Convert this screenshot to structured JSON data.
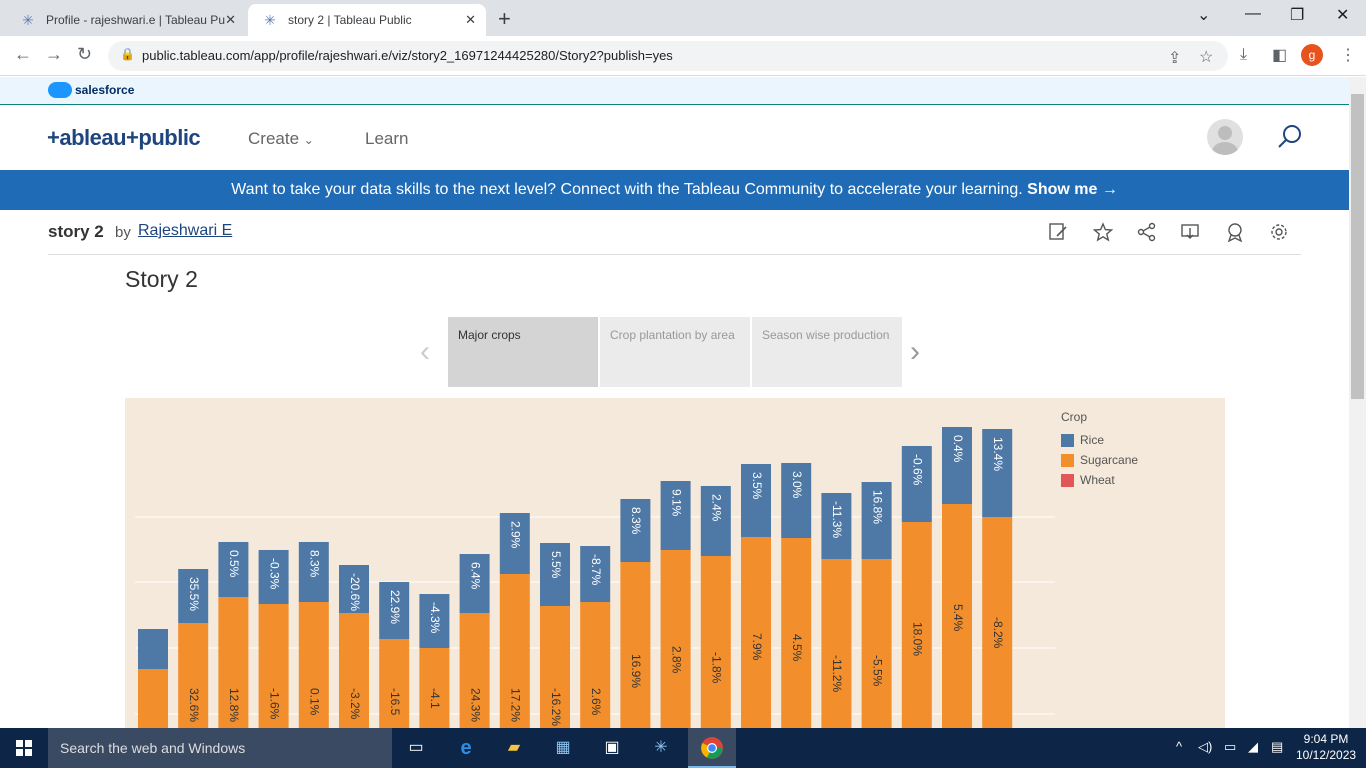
{
  "browser": {
    "tabs": [
      {
        "title": "Profile - rajeshwari.e | Tableau Pu"
      },
      {
        "title": "story 2 | Tableau Public"
      }
    ],
    "url": "public.tableau.com/app/profile/rajeshwari.e/viz/story2_16971244425280/Story2?publish=yes",
    "profile_initial": "g"
  },
  "salesforce": {
    "label": "salesforce"
  },
  "header": {
    "logo": "+ableau+public",
    "nav": [
      {
        "label": "Create"
      },
      {
        "label": "Learn"
      }
    ]
  },
  "banner": {
    "text": "Want to take your data skills to the next level? Connect with the Tableau Community to accelerate your learning.",
    "link": "Show me →"
  },
  "viz": {
    "title": "story 2",
    "by": "by",
    "author": "Rajeshwari E"
  },
  "story": {
    "title": "Story 2",
    "points": [
      {
        "label": "Major crops",
        "active": true
      },
      {
        "label": "Crop plantation by area",
        "active": false
      },
      {
        "label": "Season wise production",
        "active": false
      }
    ]
  },
  "chart_data": {
    "type": "bar",
    "stacked": true,
    "legend_title": "Crop",
    "series": [
      {
        "name": "Rice",
        "color": "#4e79a7",
        "labels": [
          "",
          "35.5%",
          "0.5%",
          "-0.3%",
          "8.3%",
          "-20.6%",
          "22.9%",
          "-4.3%",
          "6.4%",
          "2.9%",
          "5.5%",
          "-8.7%",
          "8.3%",
          "9.1%",
          "2.4%",
          "3.5%",
          "3.0%",
          "-11.3%",
          "16.8%",
          "-0.6%",
          "0.4%",
          "13.4%"
        ]
      },
      {
        "name": "Sugarcane",
        "color": "#f28e2b",
        "labels": [
          "",
          "32.6%",
          "12.8%",
          "-1.6%",
          "0.1%",
          "-3.2%",
          "-16.5",
          "-4.1",
          "24.3%",
          "17.2%",
          "-16.2%",
          "2.6%",
          "16.9%",
          "2.8%",
          "-1.8%",
          "7.9%",
          "4.5%",
          "-11.2%",
          "-5.5%",
          "18.0%",
          "5.4%",
          "-8.2%"
        ]
      },
      {
        "name": "Wheat",
        "color": "#e15759",
        "labels": []
      }
    ]
  },
  "taskbar": {
    "search_placeholder": "Search the web and Windows",
    "time": "9:04 PM",
    "date": "10/12/2023"
  }
}
